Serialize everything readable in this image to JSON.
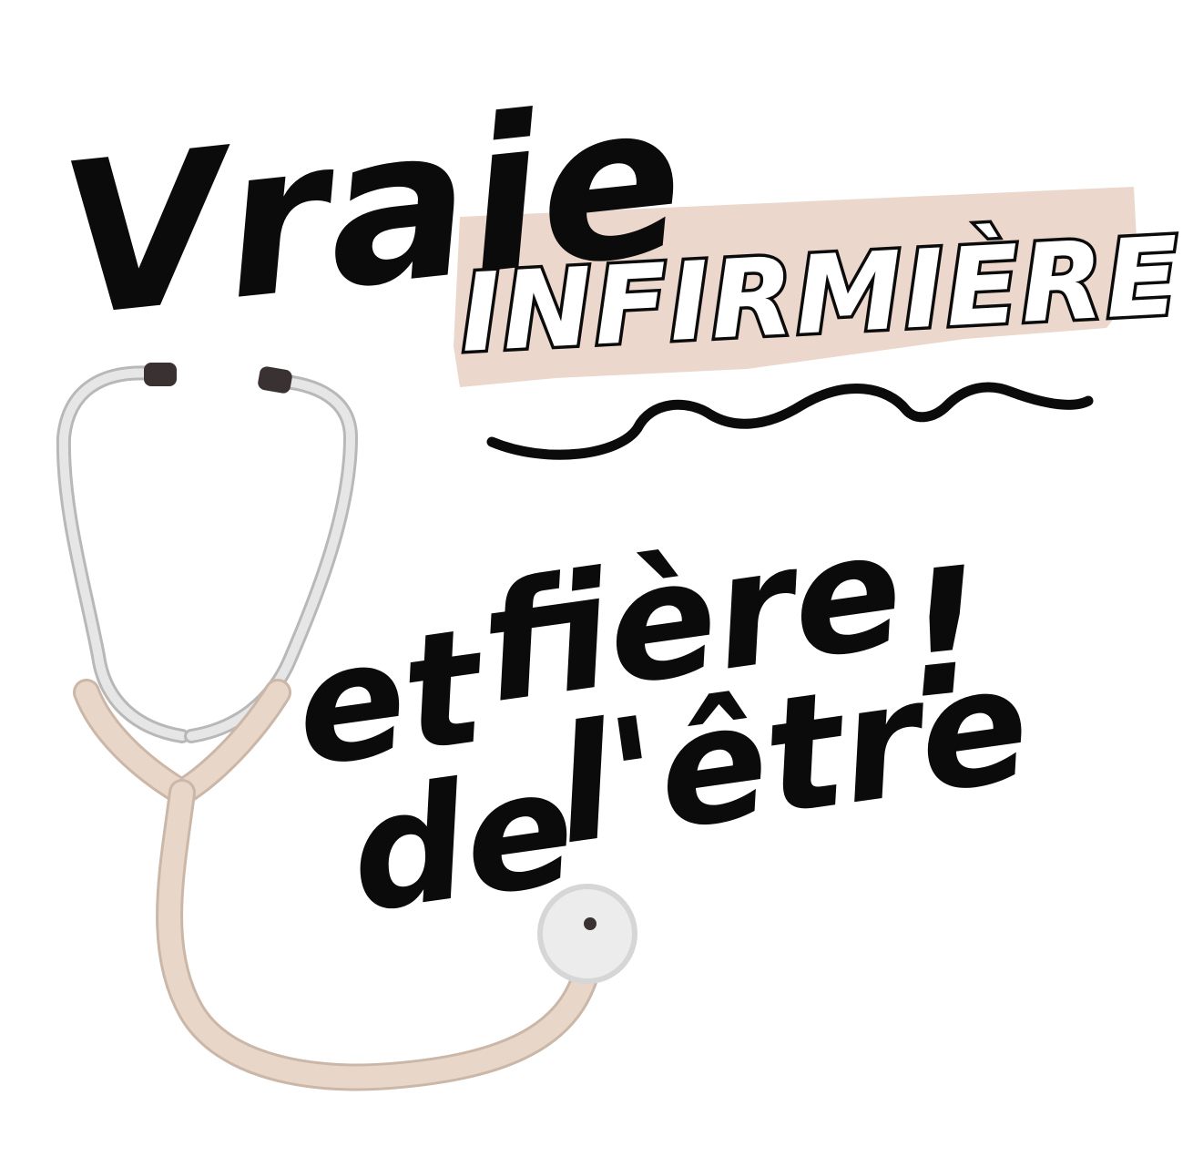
{
  "design": {
    "line1": "Vraie",
    "line2": "INFIRMIÈRE",
    "line3_word1": "et",
    "line3_word2": "fière",
    "line4_word1": "de",
    "line4_word2": "l'être",
    "line4_mark": "!"
  },
  "colors": {
    "ink": "#0b0b0b",
    "brush": "#e9d3c6",
    "tube": "#e8d7c9",
    "tube_outline": "#cbb7a8",
    "steel": "#d9d9d9",
    "steel_outline": "#b8b8b8",
    "earpiece": "#3a3133",
    "chestpiece": "#e6e6e6"
  },
  "icons": {
    "illustration": "stethoscope-icon",
    "underline": "squiggle-line",
    "highlight": "brush-stroke"
  }
}
